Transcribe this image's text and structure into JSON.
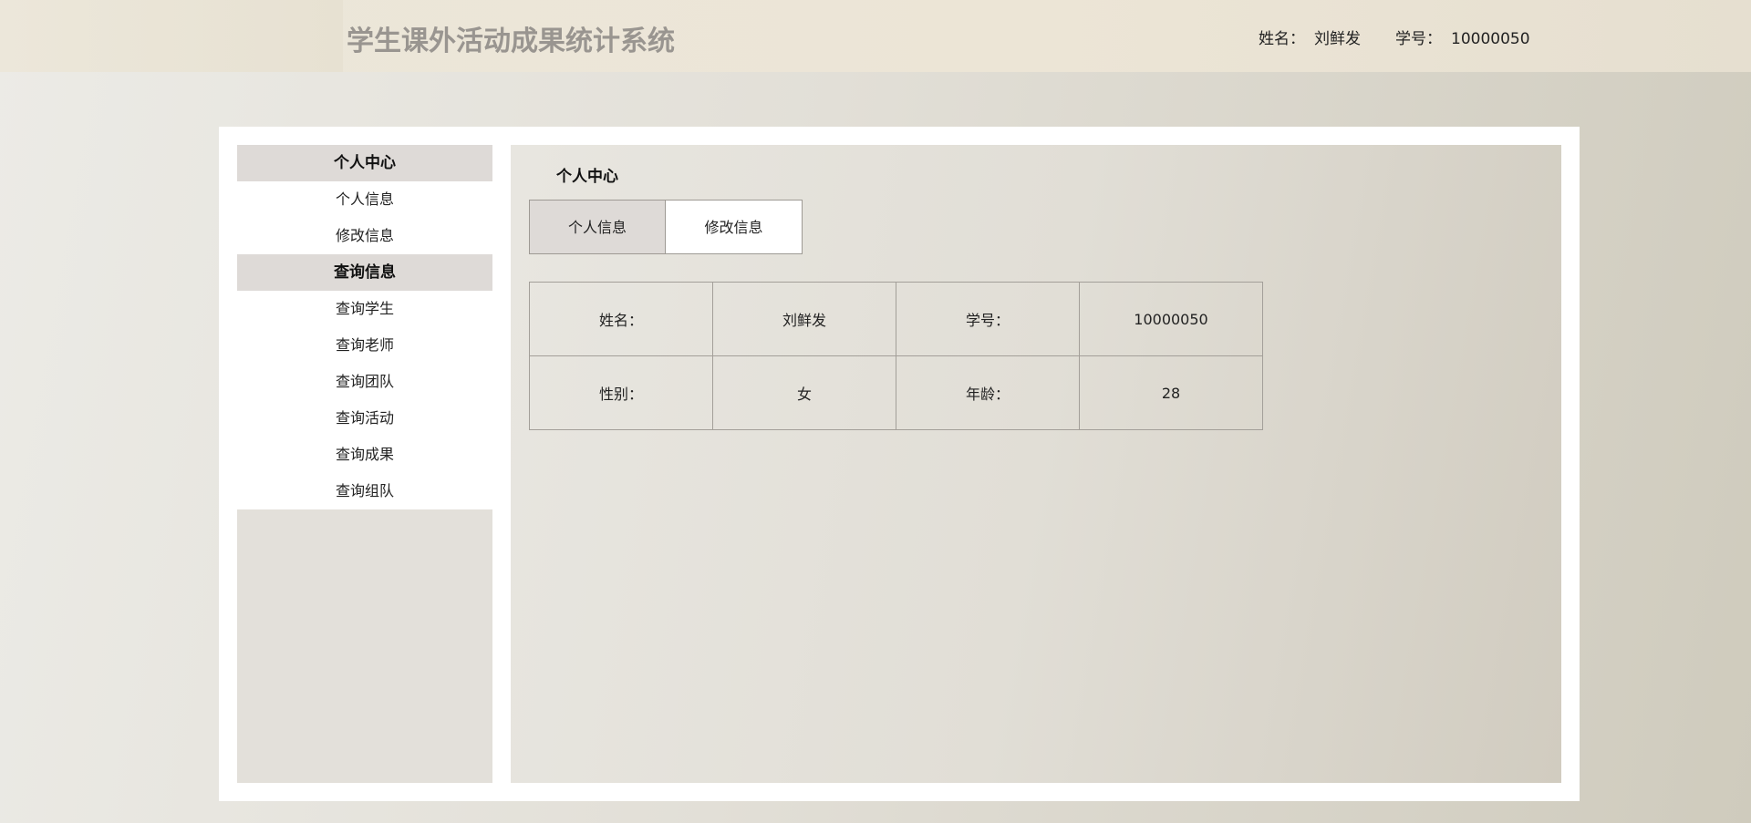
{
  "header": {
    "title": "学生课外活动成果统计系统",
    "name_label": "姓名：",
    "name_value": "刘鲜发",
    "id_label": "学号：",
    "id_value": "10000050"
  },
  "sidebar": {
    "groups": [
      {
        "label": "个人中心",
        "items": [
          {
            "label": "个人信息"
          },
          {
            "label": "修改信息"
          }
        ]
      },
      {
        "label": "查询信息",
        "items": [
          {
            "label": "查询学生"
          },
          {
            "label": "查询老师"
          },
          {
            "label": "查询团队"
          },
          {
            "label": "查询活动"
          },
          {
            "label": "查询成果"
          },
          {
            "label": "查询组队"
          }
        ]
      }
    ]
  },
  "main": {
    "title": "个人中心",
    "tabs": [
      {
        "label": "个人信息",
        "active": true
      },
      {
        "label": "修改信息",
        "active": false
      }
    ],
    "info_table": {
      "rows": [
        [
          "姓名：",
          "刘鲜发",
          "学号：",
          "10000050"
        ],
        [
          "性别：",
          "女",
          "年龄：",
          "28"
        ]
      ]
    }
  },
  "colors": {
    "title_text": "#999590",
    "active_bg": "#dedad7",
    "panel_bg": "#ffffff"
  }
}
